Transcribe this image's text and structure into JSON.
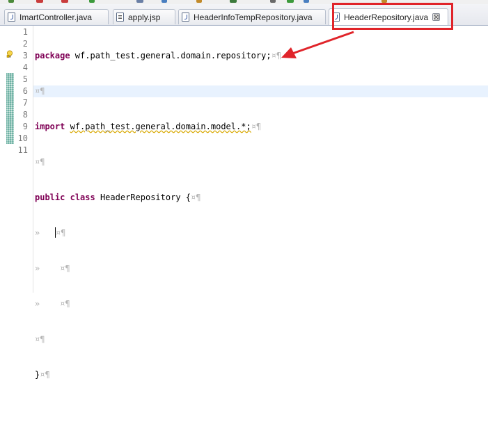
{
  "tabs": [
    {
      "label": "ImartController.java",
      "icon": "java-file-icon",
      "active": false
    },
    {
      "label": "apply.jsp",
      "icon": "jsp-file-icon",
      "active": false
    },
    {
      "label": "HeaderInfoTempRepository.java",
      "icon": "java-file-icon",
      "active": false
    },
    {
      "label": "HeaderRepository.java",
      "icon": "java-file-icon",
      "active": true,
      "close": "⊠"
    }
  ],
  "editor": {
    "line_numbers": [
      "1",
      "2",
      "3",
      "4",
      "5",
      "6",
      "7",
      "8",
      "9",
      "10",
      "11"
    ],
    "lines": {
      "l1_kw": "package",
      "l1_text": " wf.path_test.general.domain.repository;",
      "l3_kw": "import",
      "l3_text": "wf.path_test.general.domain.model.*;",
      "l5_kw1": "public",
      "l5_kw2": "class",
      "l5_text": " HeaderRepository {",
      "l10_text": "}"
    },
    "whitespace_marks": {
      "eol": "¤¶",
      "tab": "»"
    }
  },
  "colors": {
    "keyword": "#7f0055",
    "annotation_red": "#e0242a",
    "change_bar": "#6fb2a4",
    "current_line": "#e8f2fe"
  }
}
